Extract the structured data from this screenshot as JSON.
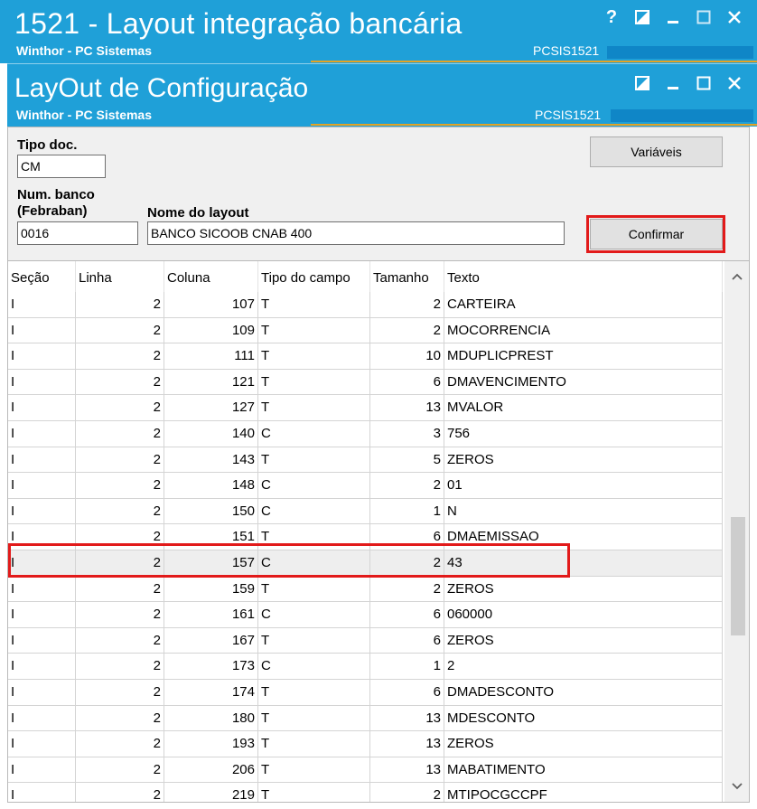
{
  "outer_window": {
    "title": "1521 - Layout integração bancária",
    "subtitle": "Winthor - PC Sistemas",
    "code": "PCSIS1521",
    "help": "?"
  },
  "inner_window": {
    "title": "LayOut de Configuração",
    "subtitle": "Winthor - PC Sistemas",
    "code": "PCSIS1521"
  },
  "form": {
    "tipo_doc_label": "Tipo doc.",
    "tipo_doc_value": "CM",
    "num_banco_label_1": "Num. banco",
    "num_banco_label_2": "(Febraban)",
    "num_banco_value": "0016",
    "nome_layout_label": "Nome do layout",
    "nome_layout_value": "BANCO SICOOB CNAB 400",
    "variaveis_label": "Variáveis",
    "confirmar_label": "Confirmar"
  },
  "grid": {
    "columns": [
      "Seção",
      "Linha",
      "Coluna",
      "Tipo do campo",
      "Tamanho",
      "Texto"
    ],
    "rows": [
      [
        "I",
        "2",
        "107",
        "T",
        "2",
        "CARTEIRA"
      ],
      [
        "I",
        "2",
        "109",
        "T",
        "2",
        "MOCORRENCIA"
      ],
      [
        "I",
        "2",
        "111",
        "T",
        "10",
        "MDUPLICPREST"
      ],
      [
        "I",
        "2",
        "121",
        "T",
        "6",
        "DMAVENCIMENTO"
      ],
      [
        "I",
        "2",
        "127",
        "T",
        "13",
        "MVALOR"
      ],
      [
        "I",
        "2",
        "140",
        "C",
        "3",
        "756"
      ],
      [
        "I",
        "2",
        "143",
        "T",
        "5",
        "ZEROS"
      ],
      [
        "I",
        "2",
        "148",
        "C",
        "2",
        "01"
      ],
      [
        "I",
        "2",
        "150",
        "C",
        "1",
        "N"
      ],
      [
        "I",
        "2",
        "151",
        "T",
        "6",
        "DMAEMISSAO"
      ],
      [
        "I",
        "2",
        "157",
        "C",
        "2",
        "43"
      ],
      [
        "I",
        "2",
        "159",
        "T",
        "2",
        "ZEROS"
      ],
      [
        "I",
        "2",
        "161",
        "C",
        "6",
        "060000"
      ],
      [
        "I",
        "2",
        "167",
        "T",
        "6",
        "ZEROS"
      ],
      [
        "I",
        "2",
        "173",
        "C",
        "1",
        "2"
      ],
      [
        "I",
        "2",
        "174",
        "T",
        "6",
        "DMADESCONTO"
      ],
      [
        "I",
        "2",
        "180",
        "T",
        "13",
        "MDESCONTO"
      ],
      [
        "I",
        "2",
        "193",
        "T",
        "13",
        "ZEROS"
      ],
      [
        "I",
        "2",
        "206",
        "T",
        "13",
        "MABATIMENTO"
      ],
      [
        "I",
        "2",
        "219",
        "T",
        "2",
        "MTIPOCGCCPF"
      ]
    ],
    "selected_row": 10
  },
  "colors": {
    "title_bar": "#1fa0d8",
    "accent_line": "#e4a323",
    "highlight": "#e21a1a"
  }
}
